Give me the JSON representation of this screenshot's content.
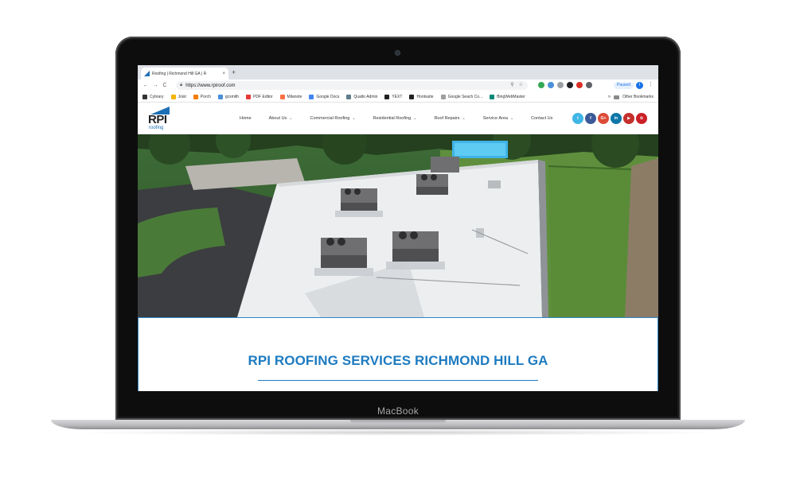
{
  "device": {
    "label": "MacBook"
  },
  "browser": {
    "tab": {
      "title": "Roofing | Richmond Hill GA | R",
      "close": "×"
    },
    "new_tab": "+",
    "nav": {
      "back": "←",
      "forward": "→",
      "reload": "C"
    },
    "url": "https://www.rpiroof.com",
    "omnibox_icons": [
      "search-icon",
      "star-icon"
    ],
    "extensions": [
      "#34a853",
      "#4a90d9",
      "#9aa0a6",
      "#202124",
      "#d93025",
      "#5f6368"
    ],
    "profile": {
      "status": "Paused",
      "initial": "I"
    },
    "menu": "⋮",
    "bookmarks": [
      {
        "label": "Cybrary",
        "color": "#333333"
      },
      {
        "label": "Joist",
        "color": "#f4b400"
      },
      {
        "label": "Porch",
        "color": "#f57c00"
      },
      {
        "label": "gcsmith",
        "color": "#4a90d9"
      },
      {
        "label": "PDF Editor",
        "color": "#e53935"
      },
      {
        "label": "Milanote",
        "color": "#ff7043"
      },
      {
        "label": "Google Docs",
        "color": "#4285f4"
      },
      {
        "label": "Qualto Admin",
        "color": "#607d8b"
      },
      {
        "label": "YEXT",
        "color": "#222222"
      },
      {
        "label": "Hootsuite",
        "color": "#222222"
      },
      {
        "label": "Google Seach Co...",
        "color": "#9e9e9e"
      },
      {
        "label": "BingWebMaster",
        "color": "#00897b"
      }
    ],
    "more_bookmarks": "»",
    "other_bookmarks": "Other Bookmarks"
  },
  "site": {
    "logo": {
      "text": "RPI",
      "sub": "roofing"
    },
    "nav": [
      {
        "label": "Home",
        "dropdown": false
      },
      {
        "label": "About Us",
        "dropdown": true
      },
      {
        "label": "Commercial Roofing",
        "dropdown": true
      },
      {
        "label": "Residential Roofing",
        "dropdown": true
      },
      {
        "label": "Roof Repairs",
        "dropdown": true
      },
      {
        "label": "Service Area",
        "dropdown": true
      },
      {
        "label": "Contact Us",
        "dropdown": false
      }
    ],
    "social": [
      {
        "label": "t",
        "color": "#3fb6e6"
      },
      {
        "label": "f",
        "color": "#3b5998"
      },
      {
        "label": "G+",
        "color": "#dd4b39"
      },
      {
        "label": "in",
        "color": "#0e76a8"
      },
      {
        "label": "▶",
        "color": "#c4302b"
      },
      {
        "label": "✿",
        "color": "#cb2027"
      }
    ],
    "headline": "RPI ROOFING SERVICES RICHMOND HILL GA",
    "colors": {
      "accent": "#1d7bc0"
    }
  }
}
